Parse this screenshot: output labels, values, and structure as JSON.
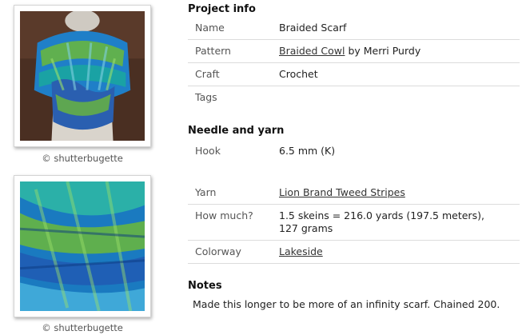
{
  "photos": [
    {
      "caption": "© shutterbugette",
      "image": "braided-scarf-on-mannequin-photo"
    },
    {
      "caption": "© shutterbugette",
      "image": "crochet-scarf-closeup-photo"
    }
  ],
  "project_info": {
    "heading": "Project info",
    "name_label": "Name",
    "name_value": "Braided Scarf",
    "pattern_label": "Pattern",
    "pattern_link": "Braided Cowl",
    "pattern_by": "by Merri Purdy",
    "craft_label": "Craft",
    "craft_value": "Crochet",
    "tags_label": "Tags",
    "tags_value": ""
  },
  "needle_yarn": {
    "heading": "Needle and yarn",
    "hook_label": "Hook",
    "hook_value": "6.5 mm (K)",
    "yarn_label": "Yarn",
    "yarn_link": "Lion Brand Tweed Stripes",
    "how_much_label": "How much?",
    "how_much_line1": "1.5 skeins = 216.0 yards (197.5 meters),",
    "how_much_line2": "127 grams",
    "colorway_label": "Colorway",
    "colorway_link": "Lakeside"
  },
  "notes": {
    "heading": "Notes",
    "text": "Made this longer to be more of an infinity scarf. Chained 200."
  },
  "colors": {
    "yarn_blue": "#1f7fc8",
    "yarn_teal": "#1aa6a0",
    "yarn_green": "#6cb83a",
    "mannequin": "#d9d4cc",
    "background_brown": "#4a2f22"
  }
}
